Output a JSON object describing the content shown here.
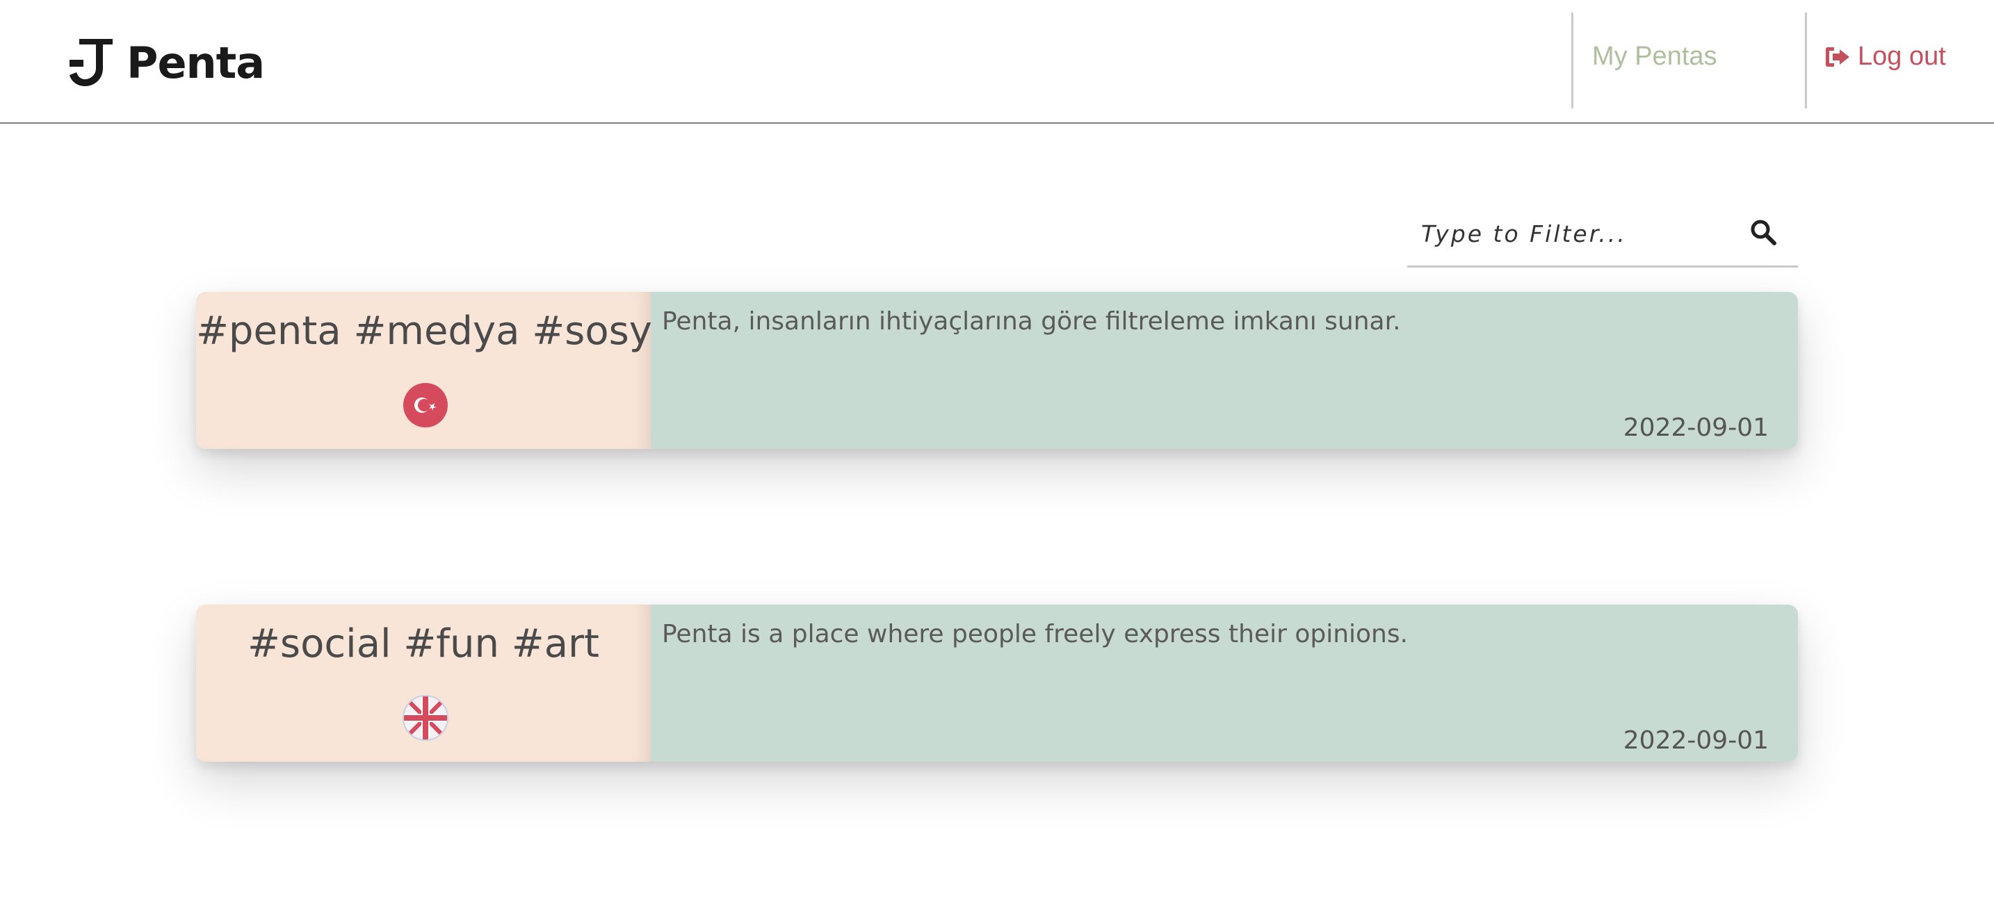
{
  "header": {
    "brand": {
      "name": "Penta",
      "logo_icon": "penta-logo-icon"
    },
    "nav": {
      "my_pentas": "My Pentas",
      "logout": "Log out",
      "logout_icon": "sign-out-icon"
    }
  },
  "filter": {
    "placeholder": "Type to Filter...",
    "value": "",
    "icon": "search-icon"
  },
  "posts": [
    {
      "tags": "#penta #medya #sosyal",
      "flag_icon": "turkey-flag-icon",
      "text": "Penta, insanların ihtiyaçlarına göre filtreleme imkanı sunar.",
      "date": "2022-09-01"
    },
    {
      "tags": "#social #fun #art",
      "flag_icon": "uk-flag-icon",
      "text": "Penta is a place where people freely express their opinions.",
      "date": "2022-09-01"
    }
  ],
  "colors": {
    "nav_my_pentas": "#aebf9e",
    "nav_logout": "#c3505c",
    "card_tags_bg": "#f9e5d7",
    "card_body_bg": "#c8dbd2",
    "flag_red": "#d64a5d"
  }
}
